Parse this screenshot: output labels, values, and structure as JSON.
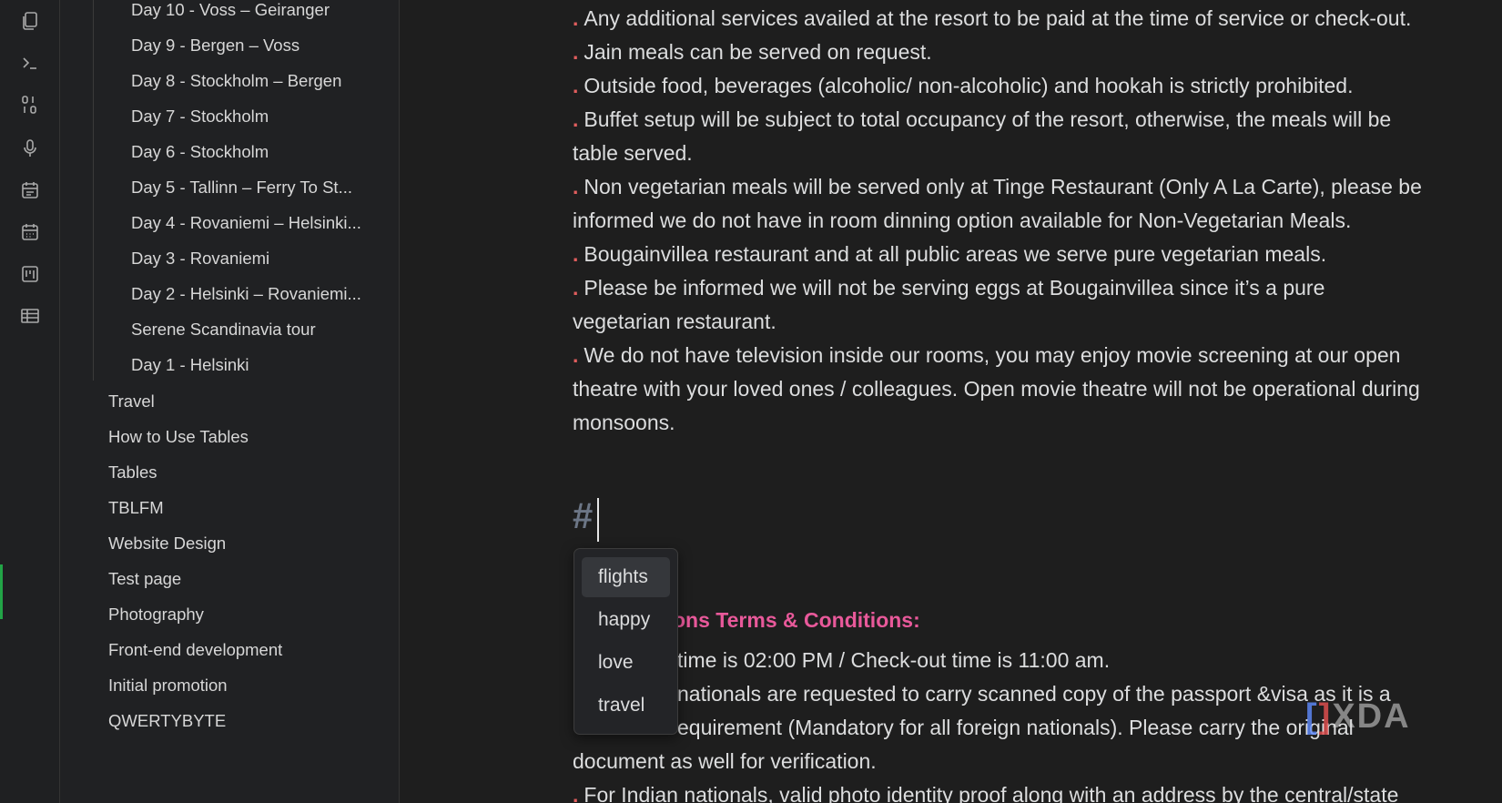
{
  "ribbon": {
    "icons": [
      "files-icon",
      "terminal-icon",
      "binary-icon",
      "microphone-icon",
      "calendar-list-icon",
      "calendar-icon",
      "kanban-icon",
      "table-icon"
    ]
  },
  "sidebar": {
    "children": [
      "Day 10 - Voss – Geiranger",
      "Day 9 - Bergen – Voss",
      "Day 8 - Stockholm – Bergen",
      "Day 7 - Stockholm",
      "Day 6 - Stockholm",
      "Day 5 - Tallinn – Ferry To St...",
      "Day 4 - Rovaniemi – Helsinki...",
      "Day 3 - Rovaniemi",
      "Day 2 - Helsinki – Rovaniemi...",
      "Serene Scandinavia tour",
      "Day 1 - Helsinki"
    ],
    "roots": [
      "Travel",
      "How to Use Tables",
      "Tables",
      "TBLFM",
      "Website Design",
      "Test page",
      "Photography",
      "Front-end development",
      "Initial promotion",
      "QWERTYBYTE"
    ]
  },
  "editor": {
    "bullet": ".",
    "lines": [
      {
        "bullet": true,
        "text": "Any additional services availed at the resort to be paid at the time of service or check-out."
      },
      {
        "bullet": true,
        "text": "Jain meals can be served on request."
      },
      {
        "bullet": true,
        "text": "Outside food, beverages (alcoholic/ non-alcoholic) and hookah is strictly prohibited."
      },
      {
        "bullet": true,
        "text": "Buffet setup will be subject to total occupancy of the resort, otherwise, the meals will be"
      },
      {
        "bullet": false,
        "text": "table served."
      },
      {
        "bullet": true,
        "text": "Non vegetarian meals will be served only at Tinge Restaurant (Only A La Carte), please be"
      },
      {
        "bullet": false,
        "text": "informed we do not have in room dinning option available for Non-Vegetarian Meals."
      },
      {
        "bullet": true,
        "text": "Bougainvillea restaurant and at all public areas we serve pure vegetarian meals."
      },
      {
        "bullet": true,
        "text": "Please be informed we will not be serving eggs at Bougainvillea since it’s a pure"
      },
      {
        "bullet": false,
        "text": "vegetarian restaurant."
      },
      {
        "bullet": true,
        "text": "We do not have television inside our rooms, you may enjoy movie screening at our open"
      },
      {
        "bullet": false,
        "text": "theatre with your loved ones / colleagues. Open movie theatre will not be operational during"
      },
      {
        "bullet": false,
        "text": "monsoons."
      }
    ],
    "heading_hash": "#",
    "terms_heading": "ons Terms & Conditions:",
    "lower_lines": [
      {
        "bullet": false,
        "text": "time is 02:00 PM / Check-out time is 11:00 am."
      },
      {
        "bullet": false,
        "text": "nationals are requested to carry scanned copy of the passport &visa as it is a"
      },
      {
        "bullet": false,
        "text": "equirement (Mandatory for all foreign nationals). Please carry the original"
      },
      {
        "bullet": false,
        "text": "document as well for verification."
      },
      {
        "bullet": true,
        "text": "For Indian nationals, valid photo identity proof along with an address by the central/state"
      }
    ]
  },
  "popup": {
    "items": [
      "flights",
      "happy",
      "love",
      "travel"
    ],
    "selected": "flights"
  },
  "watermark": {
    "brand": "XDA"
  }
}
